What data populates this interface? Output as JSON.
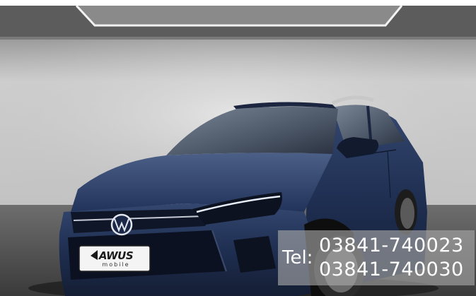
{
  "photo": {
    "subject": "car-in-showroom",
    "plate": {
      "brand": "AWUS",
      "sub": "mobile"
    },
    "contact": {
      "label": "Tel:",
      "numbers": [
        "03841-740023",
        "03841-740030"
      ]
    },
    "colors": {
      "car_body": "#1f2f52",
      "backdrop": "#cfcfcf",
      "floor": "#4e4e4e",
      "overlay": "#aaaaaa"
    }
  }
}
